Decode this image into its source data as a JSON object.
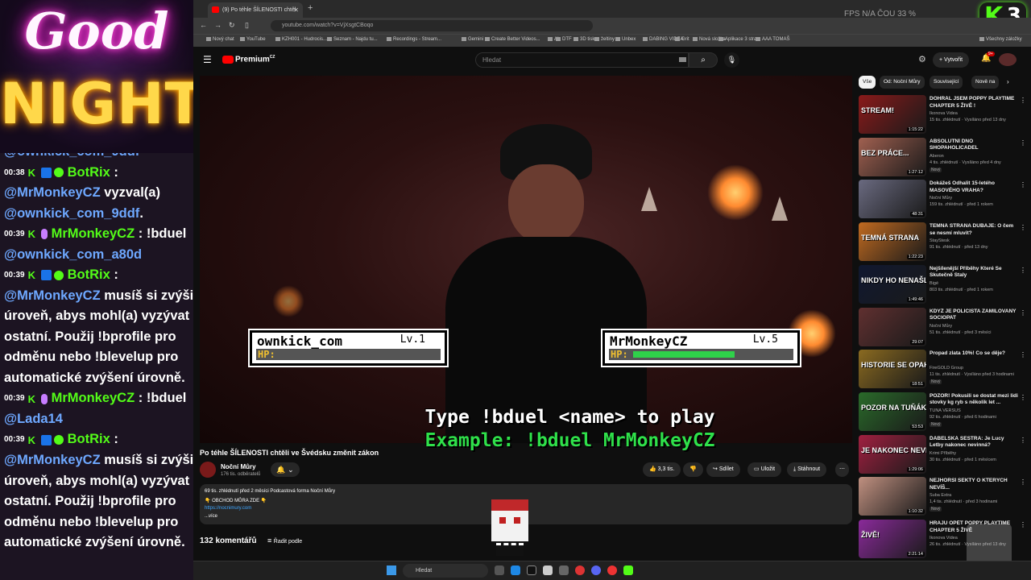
{
  "overlay": {
    "logo_good": "Good",
    "logo_night": "NIGHT",
    "fps_text": "FPS N/A   ČOU 33 %",
    "kick_letter": "K",
    "kick_count": "3"
  },
  "chat": {
    "messages": [
      {
        "time": "",
        "user": "",
        "text": "@ownkick_com_9ddf"
      },
      {
        "time": "00:38",
        "user": "BotRix",
        "text": " :"
      },
      {
        "time": "",
        "user": "",
        "mention": "@MrMonkeyCZ",
        "text": " vyzval(a)"
      },
      {
        "time": "",
        "user": "",
        "mention": "@ownkick_com_9ddf",
        "text": "."
      },
      {
        "time": "00:39",
        "user": "MrMonkeyCZ",
        "text": " : !bduel"
      },
      {
        "time": "",
        "user": "",
        "mention": "@ownkick_com_a80d",
        "text": ""
      },
      {
        "time": "00:39",
        "user": "BotRix",
        "text": " :"
      },
      {
        "time": "",
        "user": "",
        "mention": "@MrMonkeyCZ",
        "text": " musíš si zvýšit"
      },
      {
        "time": "",
        "user": "",
        "text": "úroveň, abys mohl(a) vyzývat"
      },
      {
        "time": "",
        "user": "",
        "text": "ostatní. Použij !bprofile pro"
      },
      {
        "time": "",
        "user": "",
        "text": "odměnu nebo !blevelup pro"
      },
      {
        "time": "",
        "user": "",
        "text": "automatické zvýšení úrovně."
      },
      {
        "time": "00:39",
        "user": "MrMonkeyCZ",
        "text": " : !bduel"
      },
      {
        "time": "",
        "user": "",
        "mention": "@Lada14",
        "text": ""
      },
      {
        "time": "00:39",
        "user": "BotRix",
        "text": " :"
      },
      {
        "time": "",
        "user": "",
        "mention": "@MrMonkeyCZ",
        "text": " musíš si zvýšit"
      },
      {
        "time": "",
        "user": "",
        "text": "úroveň, abys mohl(a) vyzývat"
      },
      {
        "time": "",
        "user": "",
        "text": "ostatní. Použij !bprofile pro"
      },
      {
        "time": "",
        "user": "",
        "text": "odměnu nebo !blevelup pro"
      },
      {
        "time": "",
        "user": "",
        "text": "automatické zvýšení úrovně."
      }
    ]
  },
  "browser": {
    "tab_title": "(9) Po téhle ŠÍLENOSTI chtěl",
    "new_tab": "+",
    "url": "youtube.com/watch?v=VjXsgtCBoqo",
    "bookmarks": [
      "Nový chat",
      "YouTube",
      "KZH001 - Hudrocis...",
      "Seznam - Najdu tu...",
      "Recordings - Stream...",
      "Gemini",
      "Create Better Videos...",
      "AI",
      "DTF",
      "3D tisk",
      "želtiny",
      "Unbex",
      "DABING VIDEA",
      "Grit",
      "Nová složka",
      "Aplikace 3 stran",
      "AAA TOMAŠ"
    ],
    "all_bookmarks": "Všechny záložky"
  },
  "youtube": {
    "brand": "Premium",
    "brand_sup": "CZ",
    "search_placeholder": "Hledat",
    "create_label": "Vytvořit",
    "bell_badge": "9+",
    "video_title": "Po téhle ŠÍLENOSTI chtěli ve Švédsku změnit zákon",
    "channel_name": "Noční Můry",
    "channel_subs": "176 tis. odběratelů",
    "likes": "3,3 tis.",
    "share": "Sdílet",
    "save": "Uložit",
    "download": "Stáhnout",
    "desc_meta": "69 tis. zhlédnutí  před 2 měsíci  Podcastová forma Noční Můry",
    "desc_line2": "👇 OBCHOD MŮRA ZDE 👇",
    "desc_link": "https://nocnimury.com",
    "desc_more": "...více",
    "comments_count": "132 komentářů",
    "sort_by": "Řadit podle",
    "chips": [
      "Vše",
      "Od: Noční Můry",
      "Související",
      "Nově na"
    ]
  },
  "game": {
    "p1_name": "ownkick_com",
    "p1_level": "Lv.1",
    "p1_hp_label": "HP:",
    "p1_hp": 0,
    "p2_name": "MrMonkeyCZ",
    "p2_level": "Lv.5",
    "p2_hp_label": "HP:",
    "p2_hp": 0.7,
    "instruction": "Type !bduel <name> to play",
    "example": "Example: !bduel MrMonkeyCZ"
  },
  "recommendations": [
    {
      "title": "DOHRÁL JSEM POPPY PLAYTIME CHAPTER 5 ŽIVĚ !",
      "channel": "Ikonova Videa",
      "meta": "15 tis. zhlédnutí · Vysíláno před 13 dny",
      "badge": "",
      "duration": "1:15:22",
      "thumb_text": "STREAM!",
      "color": "#8a1a1a"
    },
    {
      "title": "ABSOLUTNÍ DNO SHOPAHOLICADEL",
      "channel": "Aberon",
      "meta": "4 tis. zhlédnutí · Vysíláno před 4 dny",
      "badge": "Nový",
      "duration": "1:27:12",
      "thumb_text": "BEZ PRÁCE...",
      "color": "#a06050"
    },
    {
      "title": "Dokážeš Odhalit 15-letého MASOVÉHO VRAHA?",
      "channel": "Noční Můry",
      "meta": "159 tis. zhlédnutí · před 1 rokem",
      "badge": "",
      "duration": "48:31",
      "thumb_text": "",
      "color": "#6a6a80"
    },
    {
      "title": "TEMNÁ STRANA DUBAJE: O čem se nesmí mluvit?",
      "channel": "StayStesk",
      "meta": "91 tis. zhlédnutí · před 13 dny",
      "badge": "",
      "duration": "1:22:23",
      "thumb_text": "TEMNÁ STRANA",
      "color": "#c06a20"
    },
    {
      "title": "Nejšílenější Příběhy Které Se Skutečně Staly",
      "channel": "Bigé",
      "meta": "803 tis. zhlédnutí · před 1 rokem",
      "badge": "",
      "duration": "1:49:46",
      "thumb_text": "NIKDY HO NENAŠLI",
      "color": "#101830"
    },
    {
      "title": "KDYŽ JE POLICISTA ZAMILOVANÝ SOCIOPAT",
      "channel": "Noční Můry",
      "meta": "51 tis. zhlédnutí · před 3 měsíci",
      "badge": "",
      "duration": "29:07",
      "thumb_text": "",
      "color": "#603030"
    },
    {
      "title": "Propad zlata 10%! Co se děje?",
      "channel": "FireGOLD Group",
      "meta": "11 tis. zhlédnutí · Vysíláno před 3 hodinami",
      "badge": "Nový",
      "duration": "18:51",
      "thumb_text": "HISTORIE SE OPAKUJE",
      "color": "#8a6a20"
    },
    {
      "title": "POZOR! Pokusili se dostat mezi lidi stovky kg ryb s několik let ...",
      "channel": "TUNA VERSUS",
      "meta": "92 tis. zhlédnutí · před 6 hodinami",
      "badge": "Nový",
      "duration": "53:53",
      "thumb_text": "POZOR NA TUŇÁKA!",
      "color": "#2a6a2a"
    },
    {
      "title": "ĎÁBELSKÁ SESTRA: Je Lucy Letby nakonec nevinná?",
      "channel": "Krimi Příběhy",
      "meta": "30 tis. zhlédnutí · před 1 měsícem",
      "badge": "",
      "duration": "1:29:06",
      "thumb_text": "JE NAKONEC NEVINNÁ?",
      "color": "#a02040"
    },
    {
      "title": "NEJHORŠÍ SEKTY O KTERÝCH NEVÍŠ...",
      "channel": "Suba Extra",
      "meta": "1,4 tis. zhlédnutí · před 3 hodinami",
      "badge": "Nový",
      "duration": "1:10:32",
      "thumb_text": "",
      "color": "#c09080"
    },
    {
      "title": "HRAJU OPĚT POPPY PLAYTIME CHAPTER 5 ŽIVĚ",
      "channel": "Ikonova Videa",
      "meta": "26 tis. zhlédnutí · Vysíláno před 13 dny",
      "badge": "",
      "duration": "2:21:14",
      "thumb_text": "ŽIVĚ!",
      "color": "#8a2a9a"
    }
  ],
  "taskbar": {
    "search": "Hledat"
  }
}
